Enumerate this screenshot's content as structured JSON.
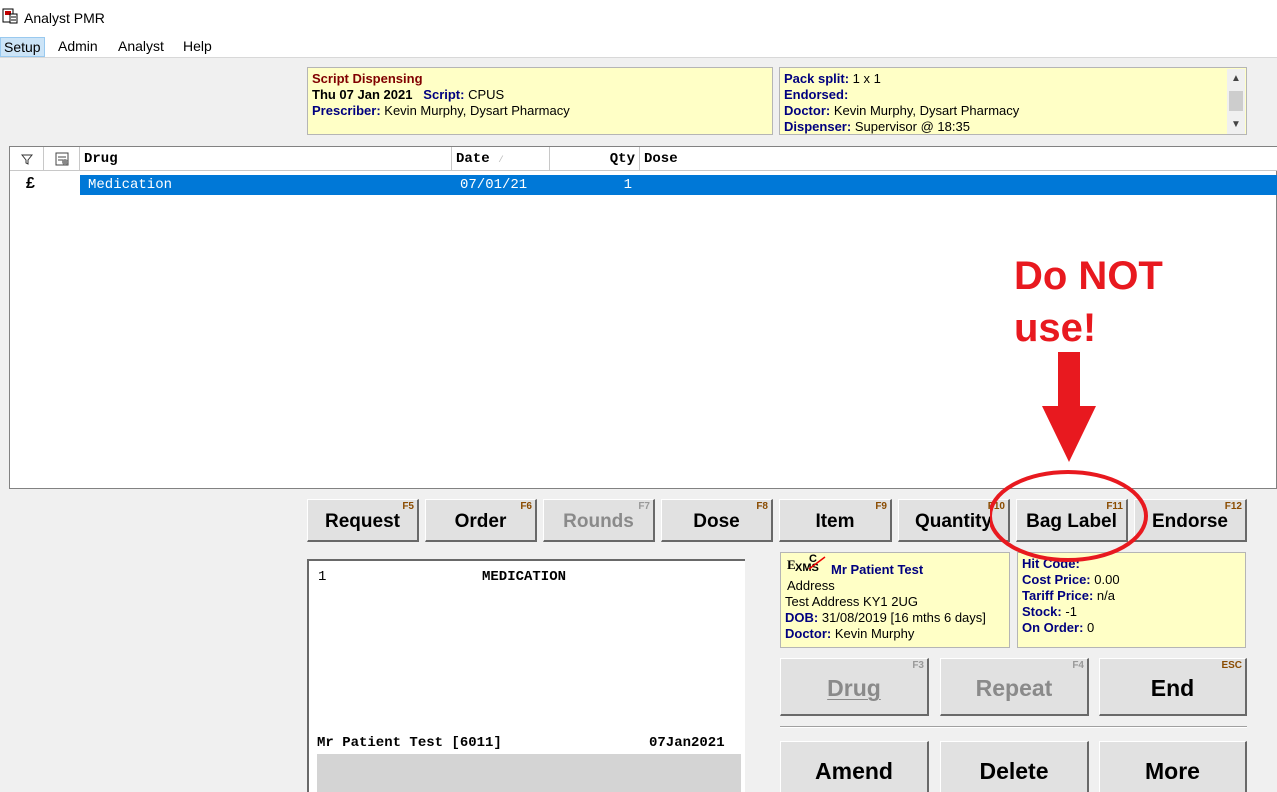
{
  "window": {
    "title": "Analyst PMR"
  },
  "menu": [
    "Setup",
    "Admin",
    "Analyst",
    "Help"
  ],
  "script_panel": {
    "heading": "Script Dispensing",
    "date": "Thu 07 Jan 2021",
    "script_label": "Script:",
    "script_value": "CPUS",
    "prescriber_label": "Prescriber:",
    "prescriber_value": "Kevin Murphy,  Dysart Pharmacy"
  },
  "pack_panel": {
    "pack_split_label": "Pack split:",
    "pack_split_value": "1 x 1",
    "endorsed_label": "Endorsed:",
    "doctor_label": "Doctor:",
    "doctor_value": "Kevin Murphy,  Dysart Pharmacy",
    "dispenser_label": "Dispenser:",
    "dispenser_value": "Supervisor @ 18:35"
  },
  "grid": {
    "columns": [
      "Drug",
      "Date",
      "Qty",
      "Dose"
    ],
    "rows": [
      {
        "icon": "£",
        "drug": "Medication",
        "date": "07/01/21",
        "qty": "1",
        "dose": ""
      }
    ]
  },
  "fkeys": [
    {
      "label": "Request",
      "key": "F5"
    },
    {
      "label": "Order",
      "key": "F6"
    },
    {
      "label": "Rounds",
      "key": "F7",
      "disabled": true
    },
    {
      "label": "Dose",
      "key": "F8"
    },
    {
      "label": "Item",
      "key": "F9"
    },
    {
      "label": "Quantity",
      "key": "F10"
    },
    {
      "label": "Bag Label",
      "key": "F11"
    },
    {
      "label": "Endorse",
      "key": "F12"
    }
  ],
  "preview": {
    "line_no": "1",
    "item": "MEDICATION",
    "patient": "Mr Patient Test [6011]",
    "date": "07Jan2021"
  },
  "patient_panel": {
    "badge_top": "C",
    "badge_left": "E",
    "badge_right": "XMS",
    "name": "Mr Patient Test",
    "address_heading": "Address",
    "address": "Test Address  KY1 2UG",
    "dob_label": "DOB:",
    "dob_value": "31/08/2019  [16 mths 6 days]",
    "doctor_label": "Doctor:",
    "doctor_value": "Kevin Murphy"
  },
  "price_panel": {
    "hit_code_label": "Hit Code:",
    "cost_label": "Cost Price:",
    "cost_value": "0.00",
    "tariff_label": "Tariff Price:",
    "tariff_value": "n/a",
    "stock_label": "Stock:",
    "stock_value": "-1",
    "onorder_label": "On Order:",
    "onorder_value": "0"
  },
  "action_buttons": {
    "drug": {
      "label": "Drug",
      "key": "F3"
    },
    "repeat": {
      "label": "Repeat",
      "key": "F4"
    },
    "end": {
      "label": "End",
      "key": "ESC"
    },
    "amend": {
      "label": "Amend"
    },
    "delete": {
      "label": "Delete"
    },
    "more": {
      "label": "More"
    }
  },
  "annotation": {
    "line1": "Do NOT",
    "line2": "use!"
  },
  "colors": {
    "selection": "#0078d7",
    "panel_yellow": "#ffffc6",
    "annotation_red": "#e8191f",
    "label_blue": "#00007f"
  }
}
